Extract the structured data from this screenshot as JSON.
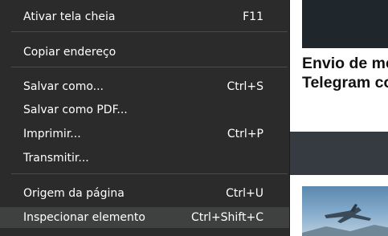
{
  "menu": {
    "items": [
      {
        "label": "Ativar tela cheia",
        "shortcut": "F11"
      },
      {
        "label": "Copiar endereço",
        "shortcut": ""
      },
      {
        "label": "Salvar como...",
        "shortcut": "Ctrl+S"
      },
      {
        "label": "Salvar como PDF...",
        "shortcut": ""
      },
      {
        "label": "Imprimir...",
        "shortcut": "Ctrl+P"
      },
      {
        "label": "Transmitir...",
        "shortcut": ""
      },
      {
        "label": "Origem da página",
        "shortcut": "Ctrl+U"
      },
      {
        "label": "Inspecionar elemento",
        "shortcut": "Ctrl+Shift+C"
      }
    ],
    "highlighted_item": "Inspecionar elemento"
  },
  "background_page": {
    "headline_line1": "Envio de men",
    "headline_line2": "Telegram com"
  },
  "colors": {
    "menu_background": "#2b2b2b",
    "menu_highlight": "#3f4141",
    "separator": "#494949",
    "band": "#353b41"
  }
}
